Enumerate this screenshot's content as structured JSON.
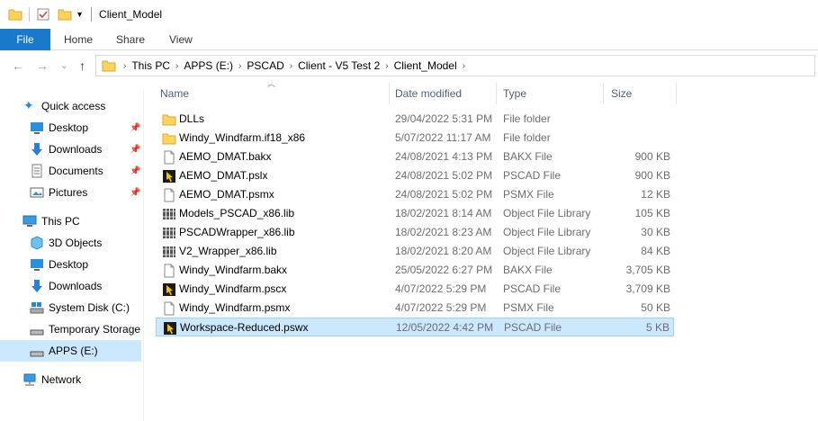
{
  "window": {
    "title": "Client_Model"
  },
  "ribbon": {
    "tabs": [
      "File",
      "Home",
      "Share",
      "View"
    ]
  },
  "address": {
    "crumbs": [
      "This PC",
      "APPS (E:)",
      "PSCAD",
      "Client - V5 Test 2",
      "Client_Model"
    ]
  },
  "sidebar": {
    "quick_access": "Quick access",
    "quick_items": [
      "Desktop",
      "Downloads",
      "Documents",
      "Pictures"
    ],
    "this_pc": "This PC",
    "pc_items": [
      "3D Objects",
      "Desktop",
      "Downloads",
      "System Disk (C:)",
      "Temporary Storage",
      "APPS (E:)"
    ],
    "network": "Network"
  },
  "columns": {
    "name": "Name",
    "date": "Date modified",
    "type": "Type",
    "size": "Size"
  },
  "files": [
    {
      "name": "DLLs",
      "date": "29/04/2022 5:31 PM",
      "type": "File folder",
      "size": "",
      "icon": "folder-icon"
    },
    {
      "name": "Windy_Windfarm.if18_x86",
      "date": "5/07/2022 11:17 AM",
      "type": "File folder",
      "size": "",
      "icon": "folder-icon"
    },
    {
      "name": "AEMO_DMAT.bakx",
      "date": "24/08/2021 4:13 PM",
      "type": "BAKX File",
      "size": "900 KB",
      "icon": "file-icon"
    },
    {
      "name": "AEMO_DMAT.pslx",
      "date": "24/08/2021 5:02 PM",
      "type": "PSCAD File",
      "size": "900 KB",
      "icon": "pscad-icon"
    },
    {
      "name": "AEMO_DMAT.psmx",
      "date": "24/08/2021 5:02 PM",
      "type": "PSMX File",
      "size": "12 KB",
      "icon": "file-icon"
    },
    {
      "name": "Models_PSCAD_x86.lib",
      "date": "18/02/2021 8:14 AM",
      "type": "Object File Library",
      "size": "105 KB",
      "icon": "library-icon"
    },
    {
      "name": "PSCADWrapper_x86.lib",
      "date": "18/02/2021 8:23 AM",
      "type": "Object File Library",
      "size": "30 KB",
      "icon": "library-icon"
    },
    {
      "name": "V2_Wrapper_x86.lib",
      "date": "18/02/2021 8:20 AM",
      "type": "Object File Library",
      "size": "84 KB",
      "icon": "library-icon"
    },
    {
      "name": "Windy_Windfarm.bakx",
      "date": "25/05/2022 6:27 PM",
      "type": "BAKX File",
      "size": "3,705 KB",
      "icon": "file-icon"
    },
    {
      "name": "Windy_Windfarm.pscx",
      "date": "4/07/2022 5:29 PM",
      "type": "PSCAD File",
      "size": "3,709 KB",
      "icon": "pscad-icon"
    },
    {
      "name": "Windy_Windfarm.psmx",
      "date": "4/07/2022 5:29 PM",
      "type": "PSMX File",
      "size": "50 KB",
      "icon": "file-icon"
    },
    {
      "name": "Workspace-Reduced.pswx",
      "date": "12/05/2022 4:42 PM",
      "type": "PSCAD File",
      "size": "5 KB",
      "icon": "pscad-icon",
      "selected": true
    }
  ],
  "colors": {
    "accent": "#1979ca",
    "selection": "#cce8ff",
    "folder": "#ffd35a"
  }
}
